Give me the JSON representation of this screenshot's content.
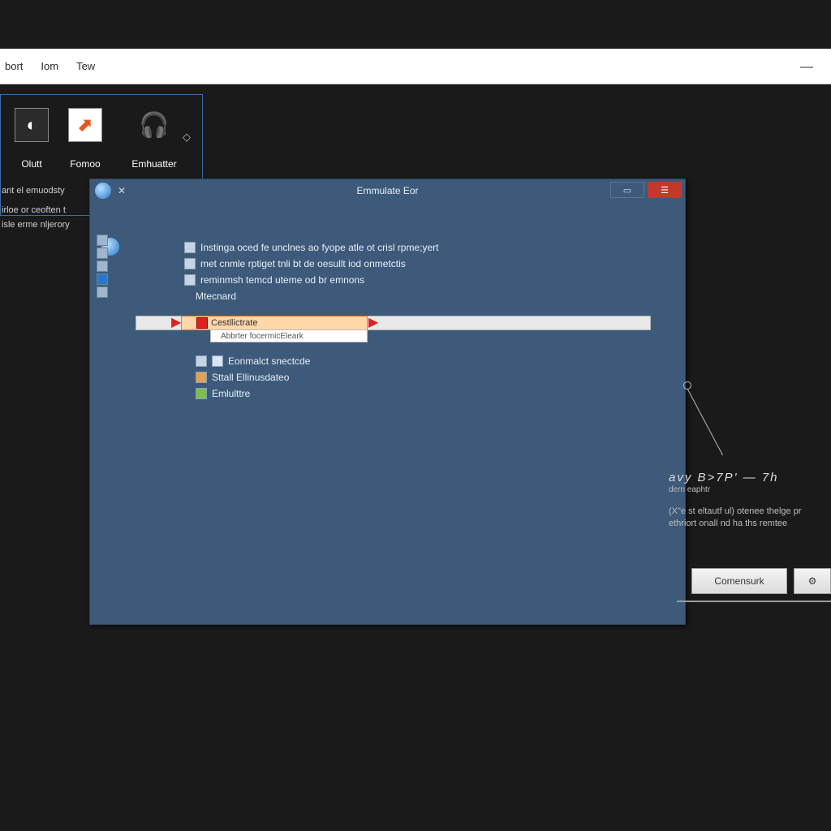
{
  "menubar": {
    "items": [
      "bort",
      "Iom",
      "Tew"
    ]
  },
  "launcher": {
    "tiles": [
      {
        "label": "Olutt"
      },
      {
        "label": "Fomoo"
      },
      {
        "label": "Emhuatter"
      }
    ]
  },
  "sidetext": {
    "line1": "ant el emuodsty",
    "line2": "irloe or ceoften t",
    "line3": "isle erme nljerory"
  },
  "modal": {
    "title": "Emmulate  Eor",
    "close_x_left": "✕",
    "tree": {
      "rows": [
        "Instinga oced fe unclnes ao fyope atle ot crisl rpme;yert",
        "met cnmle rptiget tnli bt de oesullt iod onmetctis",
        "reminmsh temcd uteme od br emnons",
        "Mtecnard"
      ],
      "highlight_label": "Cestllictrate",
      "highlight_sub": "Abbrter focermicEleark",
      "tail_rows": [
        "Eonmalct snectcde",
        "Sttall Ellinusdateo",
        "Emlulttre"
      ]
    }
  },
  "side_right": {
    "formula": "avy B>7P' — 7h",
    "formula_sub": "dern eaphtr",
    "paragraph": "(X\"e st eltautf ul) otenee thelge pr ethriort onall nd ha ths remtee"
  },
  "buttons": {
    "primary": "Comensurk"
  }
}
